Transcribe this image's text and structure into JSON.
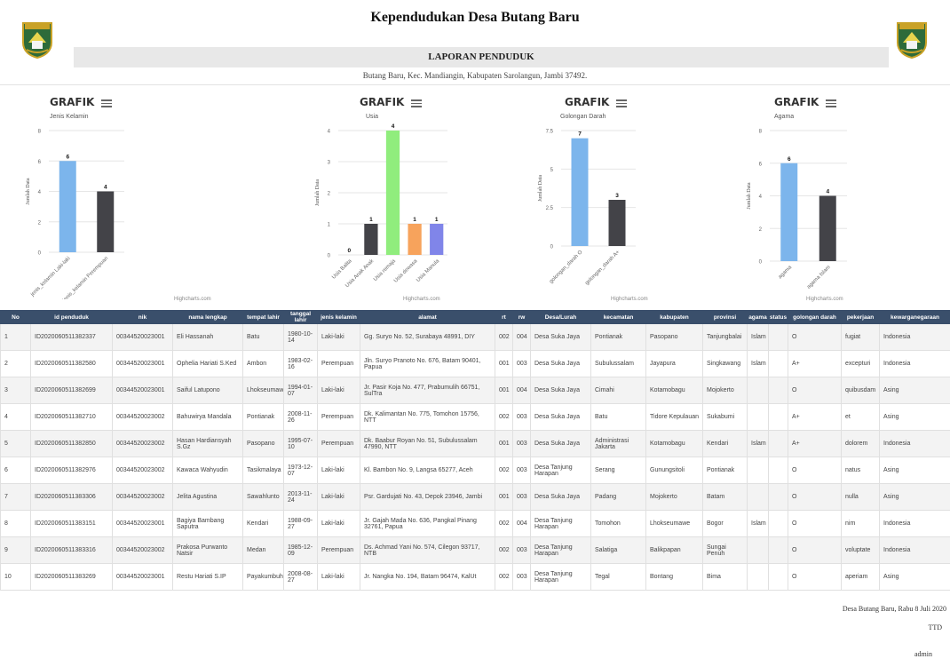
{
  "header": {
    "title": "Kependudukan Desa Butang Baru",
    "report": "LAPORAN PENDUDUK",
    "address": "Butang Baru, Kec. Mandiangin, Kabupaten Sarolangun, Jambi 37492."
  },
  "colors": {
    "header_bg": "#3a4f6b",
    "blue": "#7cb5ec",
    "dark": "#434348",
    "green": "#90ed7d",
    "orange": "#f7a35c",
    "purple": "#8085e9"
  },
  "chart_data": [
    {
      "type": "bar",
      "title": "GRAFIK",
      "subtitle": "Jenis Kelamin",
      "ylabel": "Jumlah Data",
      "ylim": [
        0,
        8
      ],
      "yticks": [
        "0",
        "2",
        "4",
        "6",
        "8"
      ],
      "categories": [
        "jenis_kelamin Laki-laki",
        "jenis_kelamin Perempuan"
      ],
      "values": [
        6,
        4
      ],
      "colors": [
        "#7cb5ec",
        "#434348"
      ],
      "credit": "Highcharts.com"
    },
    {
      "type": "bar",
      "title": "GRAFIK",
      "subtitle": "Usia",
      "ylabel": "Jumlah Data",
      "ylim": [
        0,
        4
      ],
      "yticks": [
        "0",
        "1",
        "2",
        "3",
        "4"
      ],
      "categories": [
        "Usia Balita",
        "Usia Anak Anak",
        "Usia remaja",
        "Usia dewasa",
        "Usia Manula"
      ],
      "values": [
        0,
        1,
        4,
        1,
        1
      ],
      "colors": [
        "#7cb5ec",
        "#434348",
        "#90ed7d",
        "#f7a35c",
        "#8085e9"
      ],
      "credit": "Highcharts.com"
    },
    {
      "type": "bar",
      "title": "GRAFIK",
      "subtitle": "Golongan Darah",
      "ylabel": "Jumlah Data",
      "ylim": [
        0,
        7.5
      ],
      "yticks": [
        "0",
        "2.5",
        "5",
        "7.5"
      ],
      "categories": [
        "golongan_darah O",
        "golongan_darah A+"
      ],
      "values": [
        7,
        3
      ],
      "colors": [
        "#7cb5ec",
        "#434348"
      ],
      "credit": "Highcharts.com"
    },
    {
      "type": "bar",
      "title": "GRAFIK",
      "subtitle": "Agama",
      "ylabel": "Jumlah Data",
      "ylim": [
        0,
        8
      ],
      "yticks": [
        "0",
        "2",
        "4",
        "6",
        "8"
      ],
      "categories": [
        "agama",
        "agama Islam"
      ],
      "values": [
        6,
        4
      ],
      "colors": [
        "#7cb5ec",
        "#434348"
      ],
      "credit": "Highcharts.com"
    }
  ],
  "table": {
    "columns": [
      "No",
      "id penduduk",
      "nik",
      "nama lengkap",
      "tempat lahir",
      "tanggal lahir",
      "jenis kelamin",
      "alamat",
      "rt",
      "rw",
      "Desa/Lurah",
      "kecamatan",
      "kabupaten",
      "provinsi",
      "agama",
      "status",
      "golongan darah",
      "pekerjaan",
      "kewarganegaraan"
    ],
    "rows": [
      [
        "1",
        "ID2020060511382337",
        "00344520023001",
        "Eli Hassanah",
        "Batu",
        "1980-10-14",
        "Laki-laki",
        "Gg. Suryo No. 52, Surabaya 48991, DIY",
        "002",
        "004",
        "Desa Suka Jaya",
        "Pontianak",
        "Pasopano",
        "Tanjungbalai",
        "Islam",
        "",
        "O",
        "fugiat",
        "Indonesia"
      ],
      [
        "2",
        "ID2020060511382580",
        "00344520023001",
        "Ophelia Hariati S.Ked",
        "Ambon",
        "1983-02-16",
        "Perempuan",
        "Jln. Suryo Pranoto No. 676, Batam 90401, Papua",
        "001",
        "003",
        "Desa Suka Jaya",
        "Subulussalam",
        "Jayapura",
        "Singkawang",
        "Islam",
        "",
        "A+",
        "excepturi",
        "Indonesia"
      ],
      [
        "3",
        "ID2020060511382699",
        "00344520023001",
        "Saiful Latupono",
        "Lhokseumawe",
        "1994-01-07",
        "Laki-laki",
        "Jr. Pasir Koja No. 477, Prabumulih 66751, SulTra",
        "001",
        "004",
        "Desa Suka Jaya",
        "Cimahi",
        "Kotamobagu",
        "Mojokerto",
        "",
        "",
        "O",
        "quibusdam",
        "Asing"
      ],
      [
        "4",
        "ID2020060511382710",
        "00344520023002",
        "Bahuwirya Mandala",
        "Pontianak",
        "2008-11-26",
        "Perempuan",
        "Dk. Kalimantan No. 775, Tomohon 15756, NTT",
        "002",
        "003",
        "Desa Suka Jaya",
        "Batu",
        "Tidore Kepulauan",
        "Sukabumi",
        "",
        "",
        "A+",
        "et",
        "Asing"
      ],
      [
        "5",
        "ID2020060511382850",
        "00344520023002",
        "Hasan Hardiansyah S.Gz",
        "Pasopano",
        "1995-07-10",
        "Perempuan",
        "Dk. Baabur Royan No. 51, Subulussalam 47990, NTT",
        "001",
        "003",
        "Desa Suka Jaya",
        "Administrasi Jakarta",
        "Kotamobagu",
        "Kendari",
        "Islam",
        "",
        "A+",
        "dolorem",
        "Indonesia"
      ],
      [
        "6",
        "ID2020060511382976",
        "00344520023002",
        "Kawaca Wahyudin",
        "Tasikmalaya",
        "1973-12-07",
        "Laki-laki",
        "Kl. Bambon No. 9, Langsa 65277, Aceh",
        "002",
        "003",
        "Desa Tanjung Harapan",
        "Serang",
        "Gunungsitoli",
        "Pontianak",
        "",
        "",
        "O",
        "natus",
        "Asing"
      ],
      [
        "7",
        "ID2020060511383306",
        "00344520023002",
        "Jelita Agustina",
        "Sawahlunto",
        "2013-11-24",
        "Laki-laki",
        "Psr. Gardujati No. 43, Depok 23946, Jambi",
        "001",
        "003",
        "Desa Suka Jaya",
        "Padang",
        "Mojokerto",
        "Batam",
        "",
        "",
        "O",
        "nulla",
        "Asing"
      ],
      [
        "8",
        "ID2020060511383151",
        "00344520023001",
        "Bagiya Bambang Saputra",
        "Kendari",
        "1988-09-27",
        "Laki-laki",
        "Jr. Gajah Mada No. 636, Pangkal Pinang 32761, Papua",
        "002",
        "004",
        "Desa Tanjung Harapan",
        "Tomohon",
        "Lhokseumawe",
        "Bogor",
        "Islam",
        "",
        "O",
        "nim",
        "Indonesia"
      ],
      [
        "9",
        "ID2020060511383316",
        "00344520023002",
        "Prakosa Purwanto Natsir",
        "Medan",
        "1985-12-09",
        "Perempuan",
        "Ds. Achmad Yani No. 574, Cilegon 93717, NTB",
        "002",
        "003",
        "Desa Tanjung Harapan",
        "Salatiga",
        "Balikpapan",
        "Sungai Penuh",
        "",
        "",
        "O",
        "voluptate",
        "Indonesia"
      ],
      [
        "10",
        "ID2020060511383269",
        "00344520023001",
        "Restu Hariati S.IP",
        "Payakumbuh",
        "2008-08-27",
        "Laki-laki",
        "Jr. Nangka No. 194, Batam 96474, KalUt",
        "002",
        "003",
        "Desa Tanjung Harapan",
        "Tegal",
        "Bontang",
        "Bima",
        "",
        "",
        "O",
        "aperiam",
        "Asing"
      ]
    ]
  },
  "footer": {
    "date": "Desa Butang Baru, Rabu 8 Juli 2020",
    "ttd": "TTD",
    "name": "admin"
  }
}
